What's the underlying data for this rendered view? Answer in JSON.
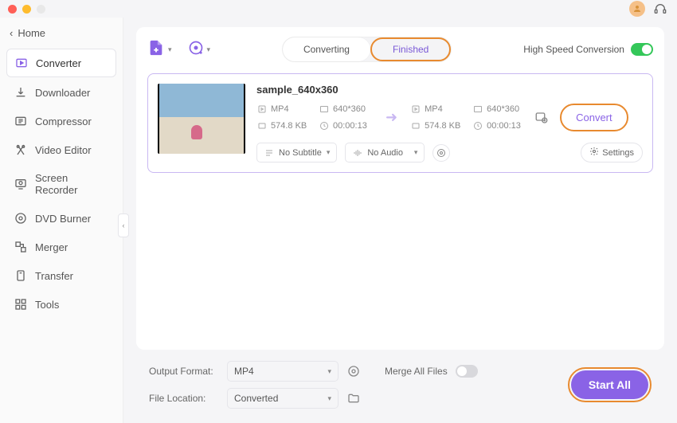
{
  "titlebar": {
    "colors": {
      "red": "#ff5f57",
      "yellow": "#febc2e"
    }
  },
  "sidebar": {
    "home": "Home",
    "items": [
      {
        "label": "Converter",
        "icon": "converter-icon",
        "active": true
      },
      {
        "label": "Downloader",
        "icon": "downloader-icon"
      },
      {
        "label": "Compressor",
        "icon": "compressor-icon"
      },
      {
        "label": "Video Editor",
        "icon": "video-editor-icon"
      },
      {
        "label": "Screen Recorder",
        "icon": "screen-recorder-icon"
      },
      {
        "label": "DVD Burner",
        "icon": "dvd-burner-icon"
      },
      {
        "label": "Merger",
        "icon": "merger-icon"
      },
      {
        "label": "Transfer",
        "icon": "transfer-icon"
      },
      {
        "label": "Tools",
        "icon": "tools-icon"
      }
    ]
  },
  "header": {
    "tabs": {
      "converting": "Converting",
      "finished": "Finished"
    },
    "high_speed_label": "High Speed Conversion",
    "high_speed_on": true
  },
  "file": {
    "name": "sample_640x360",
    "source": {
      "format": "MP4",
      "resolution": "640*360",
      "size": "574.8 KB",
      "duration": "00:00:13"
    },
    "target": {
      "format": "MP4",
      "resolution": "640*360",
      "size": "574.8 KB",
      "duration": "00:00:13"
    },
    "convert_label": "Convert",
    "subtitle": "No Subtitle",
    "audio": "No Audio",
    "settings_label": "Settings"
  },
  "footer": {
    "output_format_label": "Output Format:",
    "output_format_value": "MP4",
    "file_location_label": "File Location:",
    "file_location_value": "Converted",
    "merge_label": "Merge All Files",
    "merge_on": false,
    "start_all": "Start All"
  }
}
